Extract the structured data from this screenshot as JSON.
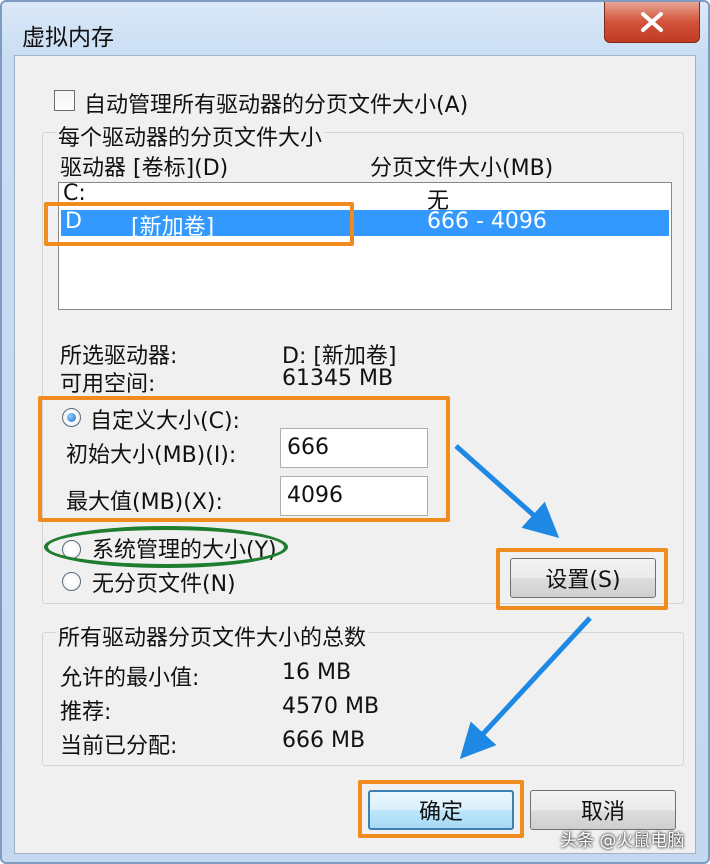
{
  "window": {
    "title": "虚拟内存"
  },
  "auto_manage": {
    "label": "自动管理所有驱动器的分页文件大小(A)",
    "checked": false
  },
  "per_drive": {
    "group_title": "每个驱动器的分页文件大小",
    "col_drive": "驱动器 [卷标](D)",
    "col_size": "分页文件大小(MB)",
    "rows": [
      {
        "drive": "C:",
        "label": "",
        "size": "无"
      },
      {
        "drive": "D",
        "label": "[新加卷]",
        "size": "666 - 4096"
      }
    ],
    "selected_drive_label": "所选驱动器:",
    "selected_drive_value": "D: [新加卷]",
    "free_space_label": "可用空间:",
    "free_space_value": "61345 MB",
    "custom_size_label": "自定义大小(C):",
    "initial_size_label": "初始大小(MB)(I):",
    "initial_size_value": "666",
    "max_size_label": "最大值(MB)(X):",
    "max_size_value": "4096",
    "system_managed_label": "系统管理的大小(Y)",
    "no_paging_label": "无分页文件(N)",
    "selected_option": "custom",
    "set_button": "设置(S)"
  },
  "totals": {
    "group_title": "所有驱动器分页文件大小的总数",
    "min_label": "允许的最小值:",
    "min_value": "16 MB",
    "recommended_label": "推荐:",
    "recommended_value": "4570 MB",
    "allocated_label": "当前已分配:",
    "allocated_value": "666 MB"
  },
  "buttons": {
    "ok": "确定",
    "cancel": "取消"
  },
  "watermark": "头条 @火鼠电脑",
  "annotation_colors": {
    "highlight": "#f08c1e",
    "ellipse": "#1e7d2e",
    "arrow": "#1e88e5"
  }
}
